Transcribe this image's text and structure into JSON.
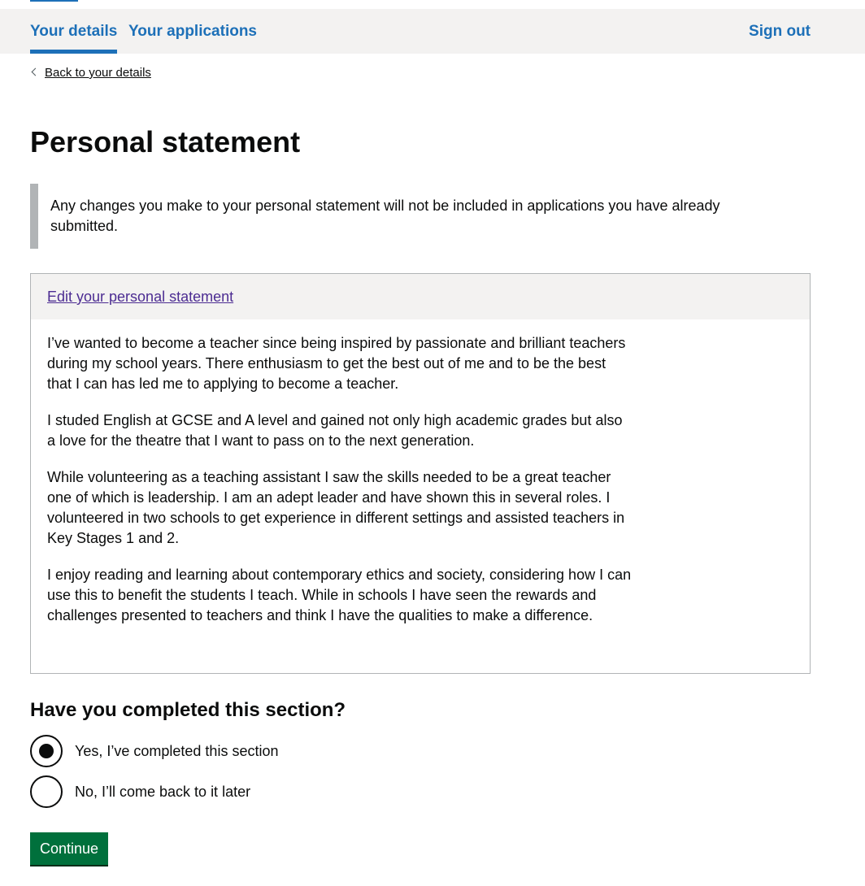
{
  "nav": {
    "tabs": [
      {
        "label": "Your details",
        "active": true
      },
      {
        "label": "Your applications",
        "active": false
      }
    ],
    "sign_out": "Sign out",
    "accent_color": "#1d70b8"
  },
  "back_link": "Back to your details",
  "page_title": "Personal statement",
  "inset_text": "Any changes you make to your personal statement will not be included in applications you have already submitted.",
  "statement": {
    "edit_link": "Edit your personal statement",
    "paragraphs": [
      "I’ve wanted to become a teacher since being inspired by passionate and brilliant teachers during my school years. There enthusiasm to get the best out of me and to be the best that I can has led me to applying to become a teacher.",
      "I studed English at GCSE and A level and gained not only high academic grades but also a love for the theatre that I want to pass on to the next generation.",
      "While volunteering as a teaching assistant I saw the skills needed to be a great teacher one of which is leadership. I am an adept leader and have shown this in several roles. I volunteered in two schools to get experience in different settings and assisted teachers in Key Stages 1 and 2.",
      "I enjoy reading and learning about contemporary ethics and society, considering how I can use this to benefit the students I teach. While in schools I have seen the rewards and challenges presented to teachers and think I have the qualities to make a difference."
    ]
  },
  "completion": {
    "question": "Have you completed this section?",
    "options": [
      {
        "label": "Yes, I’ve completed this section",
        "selected": true
      },
      {
        "label": "No, I’ll come back to it later",
        "selected": false
      }
    ]
  },
  "continue_button": "Continue",
  "colors": {
    "button_green": "#00703c",
    "visited_link": "#4c2c92",
    "nav_background": "#f3f2f1"
  }
}
